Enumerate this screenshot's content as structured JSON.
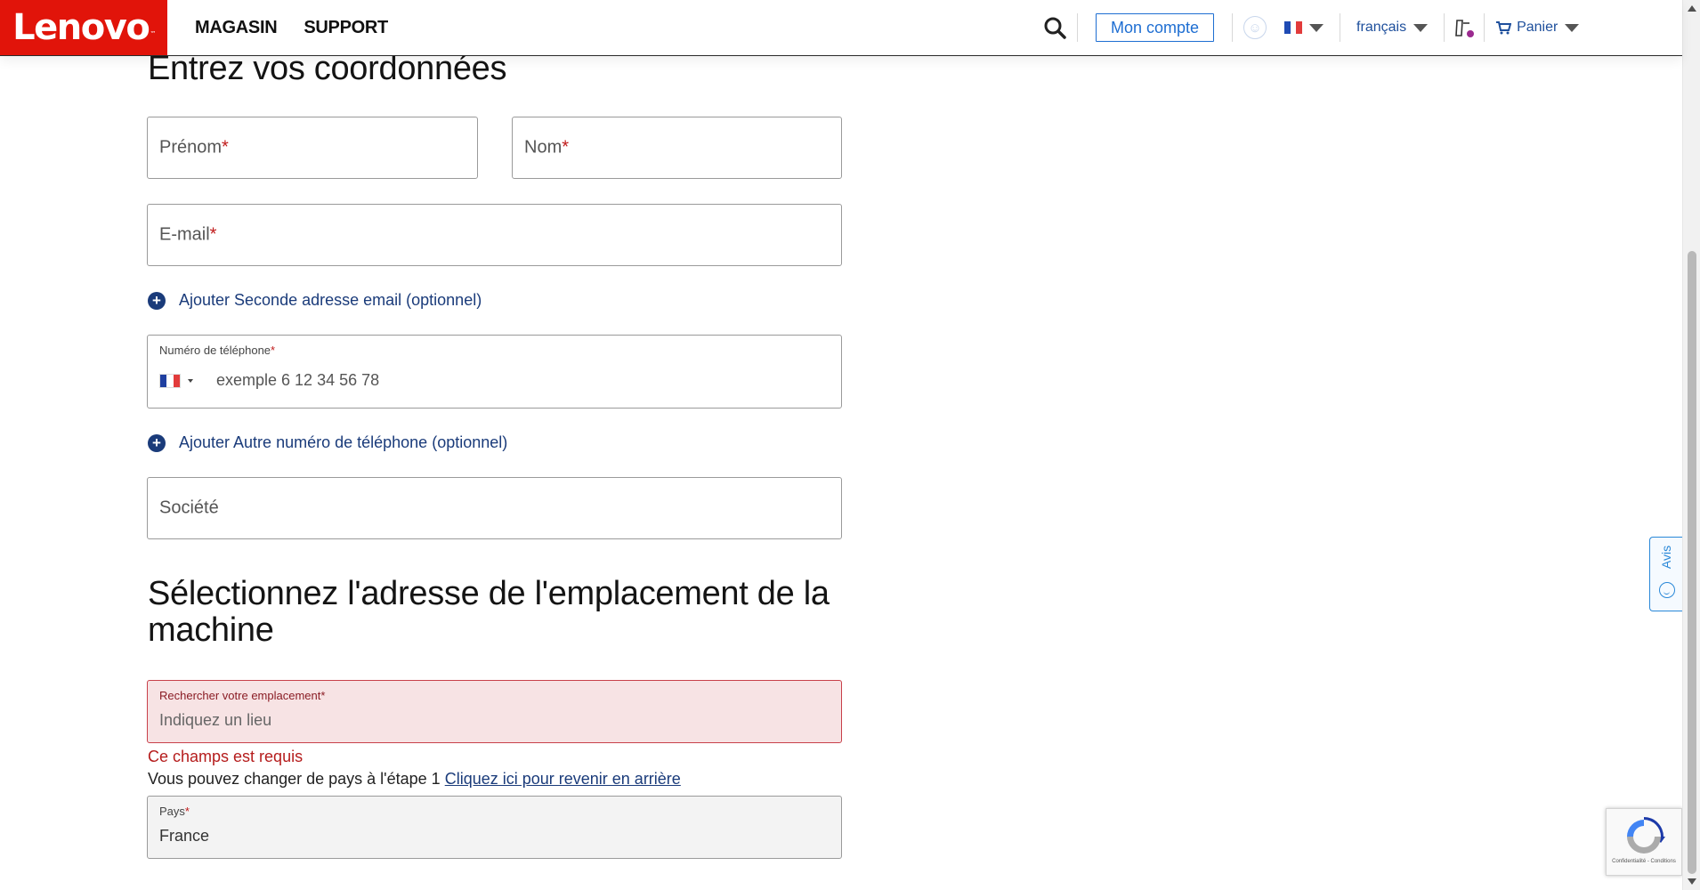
{
  "header": {
    "logo": "Lenovo",
    "logo_tm": "™",
    "nav": [
      "MAGASIN",
      "SUPPORT"
    ],
    "account_button": "Mon compte",
    "language": "français",
    "cart": "Panier",
    "icons": {
      "search": "search-icon",
      "accessibility": "accessibility-icon",
      "flag": "france-flag-icon",
      "compare": "compare-icon",
      "cart": "cart-icon"
    }
  },
  "form": {
    "title": "Entrez vos coordonnées",
    "first_name": "Prénom",
    "last_name": "Nom",
    "email": "E-mail",
    "required_mark": "*",
    "add_email": "Ajouter Seconde adresse email (optionnel)",
    "phone_label": "Numéro de téléphone",
    "phone_placeholder": "exemple 6 12 34 56 78",
    "add_phone": "Ajouter Autre numéro de téléphone (optionnel)",
    "company": "Société"
  },
  "location": {
    "title": "Sélectionnez l'adresse de l'emplacement de la machine",
    "search_label": "Rechercher votre emplacement",
    "search_placeholder": "Indiquez un lieu",
    "error": "Ce champs est requis",
    "note": "Vous pouvez changer de pays à l'étape 1",
    "note_link": "Cliquez ici pour revenir en arrière",
    "country_label": "Pays",
    "country_value": "France"
  },
  "feedback": {
    "label": "Avis"
  },
  "recaptcha": {
    "text": "Confidentialité - Conditions"
  },
  "colors": {
    "brand_red": "#e1140a",
    "link_blue": "#1a3b7a",
    "accent_blue": "#1e6ed2",
    "error_red": "#b51c1c",
    "error_bg": "#f7e3e4"
  }
}
